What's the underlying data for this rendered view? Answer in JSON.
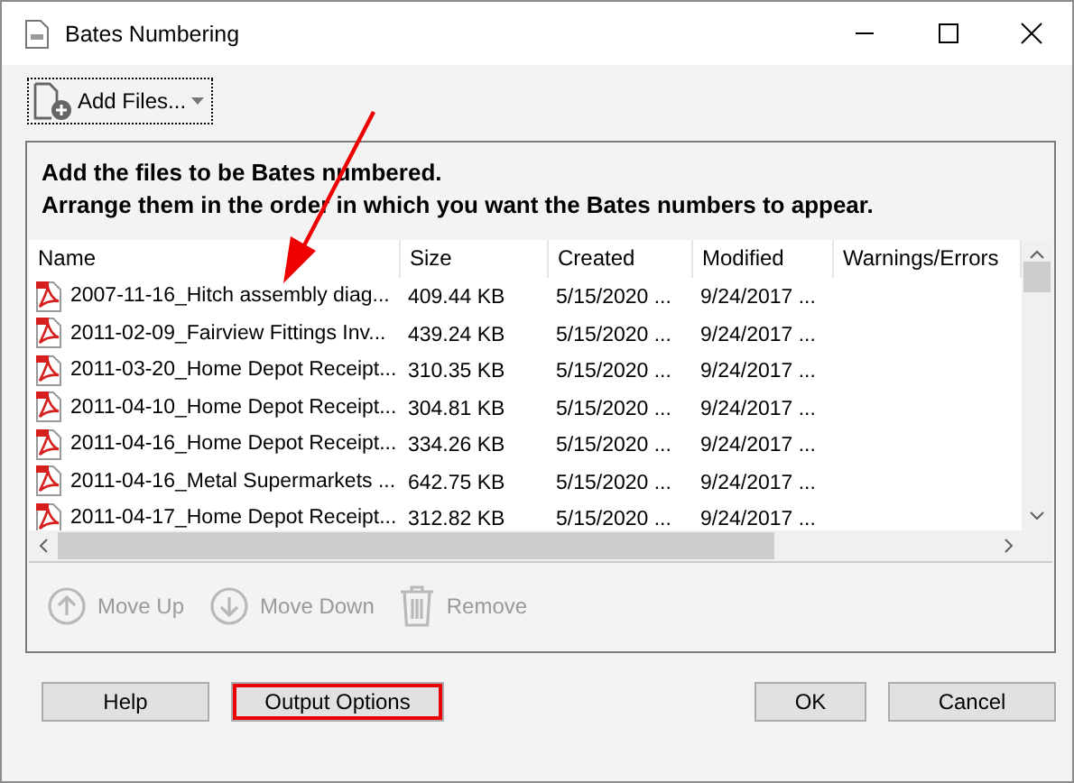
{
  "window": {
    "title": "Bates Numbering"
  },
  "toolbar": {
    "add_button": {
      "label": "Add Files...",
      "focused": true
    }
  },
  "instructions": [
    "Add the files to be Bates numbered.",
    "Arrange them in the order in which you want the Bates numbers to appear."
  ],
  "table": {
    "columns": [
      "Name",
      "Size",
      "Created",
      "Modified",
      "Warnings/Errors"
    ],
    "rows": [
      {
        "name": "2007-11-16_Hitch assembly diag...",
        "size": "409.44 KB",
        "created": "5/15/2020 ...",
        "modified": "9/24/2017 ..."
      },
      {
        "name": "2011-02-09_Fairview Fittings Inv...",
        "size": "439.24 KB",
        "created": "5/15/2020 ...",
        "modified": "9/24/2017 ..."
      },
      {
        "name": "2011-03-20_Home Depot Receipt...",
        "size": "310.35 KB",
        "created": "5/15/2020 ...",
        "modified": "9/24/2017 ..."
      },
      {
        "name": "2011-04-10_Home Depot Receipt...",
        "size": "304.81 KB",
        "created": "5/15/2020 ...",
        "modified": "9/24/2017 ..."
      },
      {
        "name": "2011-04-16_Home Depot Receipt...",
        "size": "334.26 KB",
        "created": "5/15/2020 ...",
        "modified": "9/24/2017 ..."
      },
      {
        "name": "2011-04-16_Metal Supermarkets ...",
        "size": "642.75 KB",
        "created": "5/15/2020 ...",
        "modified": "9/24/2017 ..."
      },
      {
        "name": "2011-04-17_Home Depot Receipt...",
        "size": "312.82 KB",
        "created": "5/15/2020 ...",
        "modified": "9/24/2017 ..."
      }
    ]
  },
  "list_actions": [
    {
      "kind": "up",
      "label": "Move Up",
      "disabled": true
    },
    {
      "kind": "down",
      "label": "Move Down",
      "disabled": true
    },
    {
      "kind": "remove",
      "label": "Remove",
      "disabled": true
    }
  ],
  "buttons": {
    "left": [
      {
        "label": "Help",
        "highlighted": false
      },
      {
        "label": "Output Options",
        "highlighted": true
      }
    ],
    "right": [
      {
        "label": "OK",
        "highlighted": false
      },
      {
        "label": "Cancel",
        "highlighted": false
      }
    ]
  }
}
